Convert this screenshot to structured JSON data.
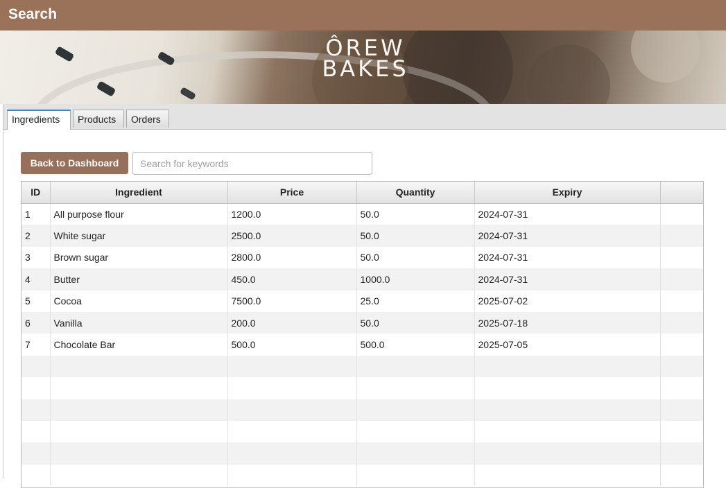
{
  "window": {
    "title": "Search"
  },
  "banner": {
    "logo_line1": "ÔREW",
    "logo_line2": "BAKES"
  },
  "tabs": [
    {
      "label": "Ingredients",
      "active": true
    },
    {
      "label": "Products",
      "active": false
    },
    {
      "label": "Orders",
      "active": false
    }
  ],
  "toolbar": {
    "back_label": "Back to Dashboard",
    "search_placeholder": "Search for keywords",
    "search_value": ""
  },
  "table": {
    "columns": [
      "ID",
      "Ingredient",
      "Price",
      "Quantity",
      "Expiry"
    ],
    "rows": [
      [
        "1",
        "All purpose flour",
        "1200.0",
        "50.0",
        "2024-07-31"
      ],
      [
        "2",
        "White sugar",
        "2500.0",
        "50.0",
        "2024-07-31"
      ],
      [
        "3",
        "Brown sugar",
        "2800.0",
        "50.0",
        "2024-07-31"
      ],
      [
        "4",
        "Butter",
        "450.0",
        "1000.0",
        "2024-07-31"
      ],
      [
        "5",
        "Cocoa",
        "7500.0",
        "25.0",
        "2025-07-02"
      ],
      [
        "6",
        "Vanilla",
        "200.0",
        "50.0",
        "2025-07-18"
      ],
      [
        "7",
        "Chocolate Bar",
        "500.0",
        "500.0",
        "2025-07-05"
      ]
    ]
  },
  "colors": {
    "accent": "#97705b",
    "title_bar": "#9a7259",
    "active_tab": "#3a86c8"
  }
}
